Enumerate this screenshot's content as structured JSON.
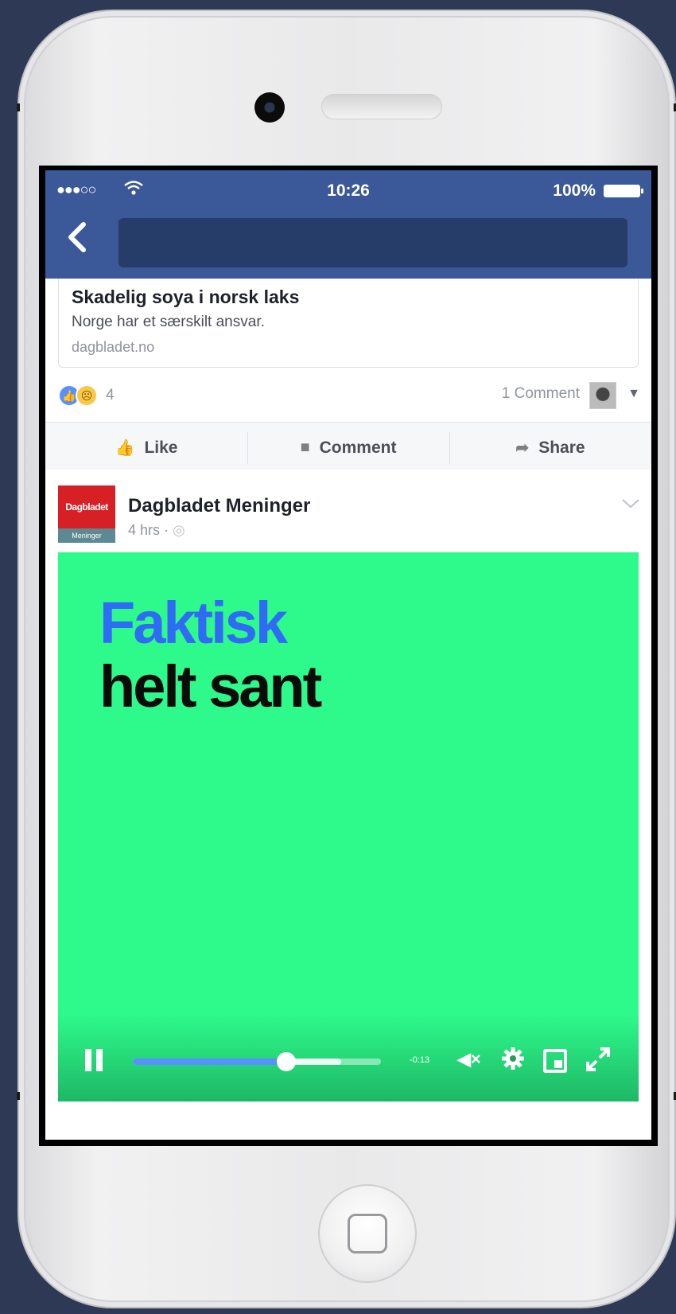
{
  "status_bar": {
    "signal": "●●●○○",
    "time": "10:26",
    "battery": "100%"
  },
  "nav": {
    "back_icon": "‹"
  },
  "link_preview": {
    "title": "Skadelig soya i norsk laks",
    "description": "Norge har et særskilt ansvar.",
    "domain": "dagbladet.no"
  },
  "reactions": {
    "count": "4",
    "comments": "1 Comment"
  },
  "actions": {
    "like": "Like",
    "comment": "Comment",
    "share": "Share"
  },
  "post": {
    "page_name": "Dagbladet Meninger",
    "meta": "4 hrs · ",
    "logo_top": "Dagbladet",
    "logo_bottom": "Meninger"
  },
  "video": {
    "line1": "Faktisk",
    "line2": "helt sant",
    "time_left": "-0:13",
    "played_fraction": 0.62,
    "buffered_fraction": 0.84
  },
  "colors": {
    "fb_blue": "#3b5998",
    "video_bg": "#2efa8b",
    "headline_blue": "#2f6bf5"
  }
}
